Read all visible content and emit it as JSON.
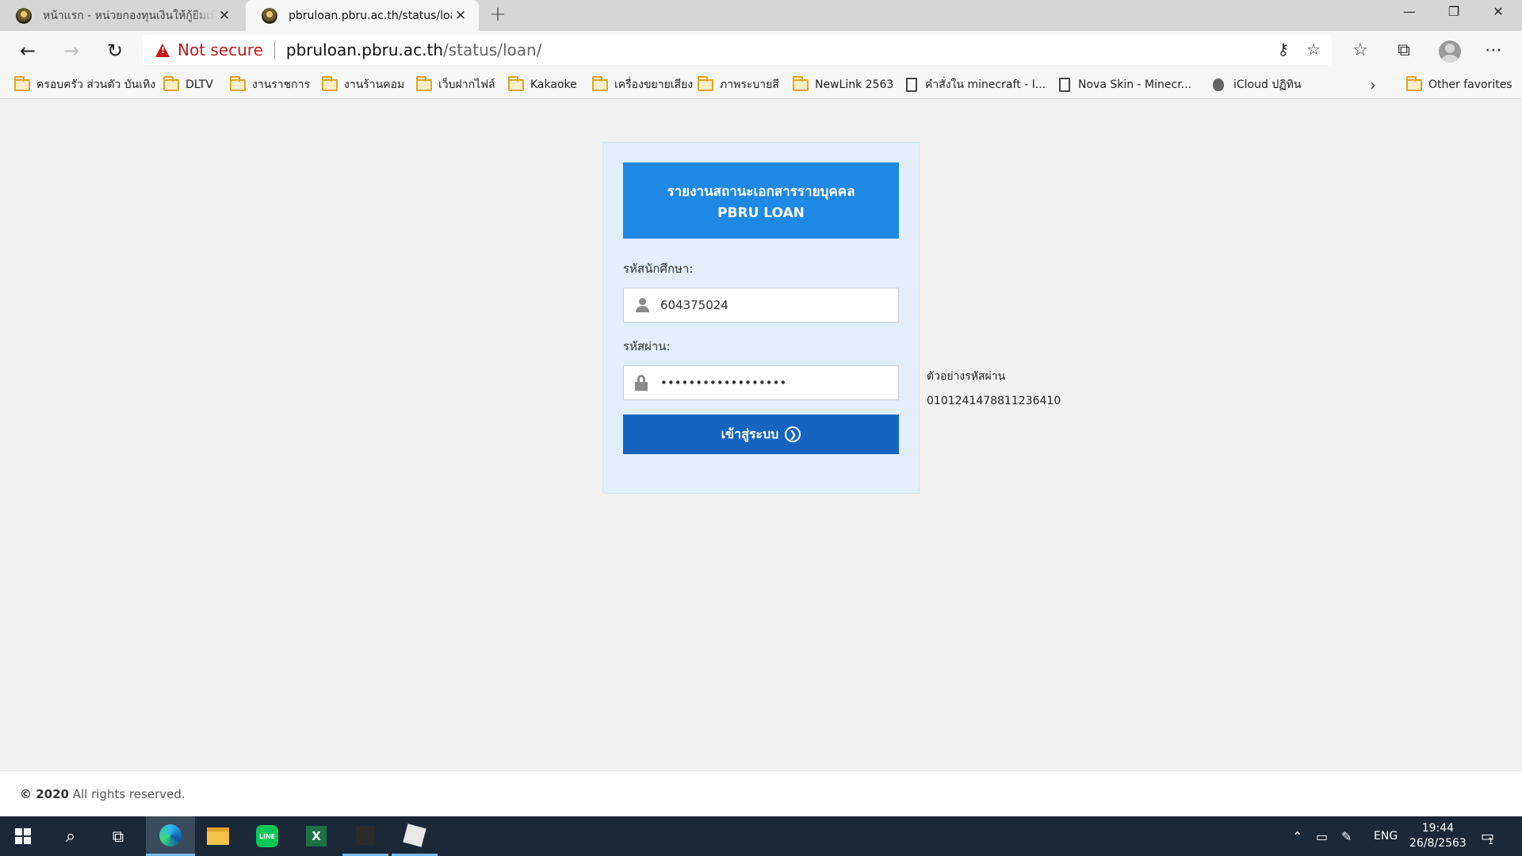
{
  "browser": {
    "tabs": [
      {
        "title": "หน้าแรก - หน่วยกองทุนเงินให้กู้ยืมเพื่อการศึกษา",
        "active": false
      },
      {
        "title": "pbruloan.pbru.ac.th/status/loan/",
        "active": true
      }
    ],
    "new_tab": "+",
    "security_label": "Not secure",
    "url_host": "pbruloan.pbru.ac.th",
    "url_path": "/status/loan/",
    "bookmarks": [
      {
        "label": "ครอบครัว ส่วนตัว บันเทิง",
        "icon": "folder-icon"
      },
      {
        "label": "DLTV",
        "icon": "folder-icon"
      },
      {
        "label": "งานราชการ",
        "icon": "folder-icon"
      },
      {
        "label": "งานร้านคอม",
        "icon": "folder-icon"
      },
      {
        "label": "เว็บฝากไฟล์",
        "icon": "folder-icon"
      },
      {
        "label": "Kakaoke",
        "icon": "folder-icon"
      },
      {
        "label": "เครื่องขยายเสียง",
        "icon": "folder-icon"
      },
      {
        "label": "ภาพระบายสี",
        "icon": "folder-icon"
      },
      {
        "label": "NewLink 2563",
        "icon": "folder-icon"
      },
      {
        "label": "คำสั่งใน minecraft - I...",
        "icon": "page-icon"
      },
      {
        "label": "Nova Skin - Minecr...",
        "icon": "page-icon"
      },
      {
        "label": "iCloud ปฏิทิน",
        "icon": "apple-icon"
      }
    ],
    "other_favorites": "Other favorites"
  },
  "login": {
    "header_line1": "รายงานสถานะเอกสารรายบุคคล",
    "header_line2": "PBRU LOAN",
    "student_id_label": "รหัสนักศึกษา:",
    "student_id_value": "604375024",
    "password_label": "รหัสผ่าน:",
    "password_value": "••••••••••••••••••",
    "submit_label": "เข้าสู่ระบบ",
    "sample_password_label": "ตัวอย่างรหัสผ่าน",
    "sample_password_value": "0101241478811236410"
  },
  "footer": {
    "year": "© 2020",
    "text": " All rights reserved."
  },
  "taskbar": {
    "language": "ENG",
    "time": "19:44",
    "date": "26/8/2563",
    "notification_count": "1"
  },
  "colors": {
    "header_blue": "#1e88e5",
    "button_blue": "#1565c0",
    "card_bg": "#e2effa",
    "warning_red": "#c5191b"
  }
}
